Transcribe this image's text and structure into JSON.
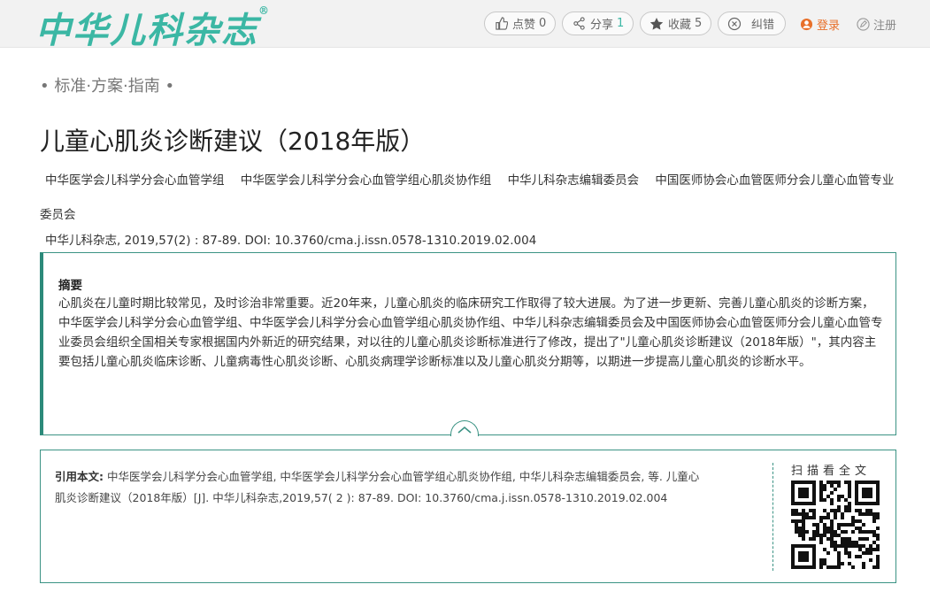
{
  "header": {
    "logo_text": "中华儿科杂志",
    "logo_mark": "®",
    "like": {
      "label": "点赞",
      "count": "0"
    },
    "share": {
      "label": "分享",
      "count": "1"
    },
    "favorite": {
      "label": "收藏",
      "count": "5"
    },
    "report": {
      "label": "纠错"
    },
    "login": {
      "label": "登录"
    },
    "register": {
      "label": "注册"
    }
  },
  "article": {
    "section": "• 标准·方案·指南 •",
    "title": "儿童心肌炎诊断建议（2018年版）",
    "authors": [
      "中华医学会儿科学分会心血管学组",
      "中华医学会儿科学分会心血管学组心肌炎协作组",
      "中华儿科杂志编辑委员会",
      "中国医师协会心血管医师分会儿童心血管专业委员会"
    ],
    "journal_line": "中华儿科杂志, 2019,57(2) : 87-89. DOI: 10.3760/cma.j.issn.0578-1310.2019.02.004"
  },
  "abstract": {
    "heading": "摘要",
    "text": "心肌炎在儿童时期比较常见，及时诊治非常重要。近20年来，儿童心肌炎的临床研究工作取得了较大进展。为了进一步更新、完善儿童心肌炎的诊断方案，中华医学会儿科学分会心血管学组、中华医学会儿科学分会心血管学组心肌炎协作组、中华儿科杂志编辑委员会及中国医师协会心血管医师分会儿童心血管专业委员会组织全国相关专家根据国内外新近的研究结果，对以往的儿童心肌炎诊断标准进行了修改，提出了\"儿童心肌炎诊断建议（2018年版）\"，其内容主要包括儿童心肌炎临床诊断、儿童病毒性心肌炎诊断、心肌炎病理学诊断标准以及儿童心肌炎分期等，以期进一步提高儿童心肌炎的诊断水平。"
  },
  "citation": {
    "label": "引用本文:",
    "text": " 中华医学会儿科学分会心血管学组, 中华医学会儿科学分会心血管学组心肌炎协作组, 中华儿科杂志编辑委员会, 等. 儿童心肌炎诊断建议（2018年版）[J]. 中华儿科杂志,2019,57( 2 ): 87-89. DOI: 10.3760/cma.j.issn.0578-1310.2019.02.004",
    "scan_label": "扫描看全文"
  },
  "colors": {
    "brand_teal": "#3bb7a4",
    "border_teal": "#3b9384",
    "login_orange": "#e8702a"
  },
  "icons": {
    "like": "thumbs-up-icon",
    "share": "share-icon",
    "favorite": "star-icon",
    "report": "report-icon",
    "login": "user-icon",
    "register": "pencil-icon",
    "expand": "chevron-up-icon",
    "qr": "qr-code-icon"
  }
}
